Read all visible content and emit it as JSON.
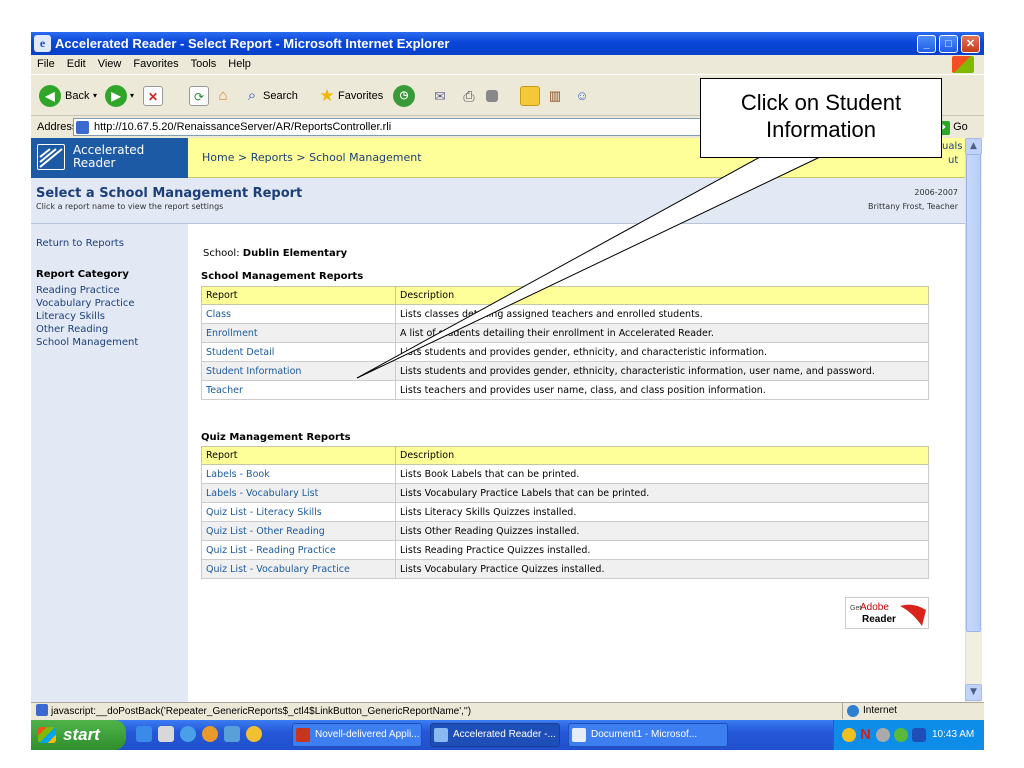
{
  "window": {
    "title": "Accelerated Reader - Select Report - Microsoft Internet Explorer",
    "minimize": "_",
    "maximize": "□",
    "close": "✕"
  },
  "menu": [
    "File",
    "Edit",
    "View",
    "Favorites",
    "Tools",
    "Help"
  ],
  "toolbar": {
    "back": "Back",
    "search": "Search",
    "favorites": "Favorites"
  },
  "address": {
    "label": "Address",
    "url": "http://10.67.5.20/RenaissanceServer/AR/ReportsController.rli",
    "go": "Go"
  },
  "app": {
    "logo_line1": "Accelerated",
    "logo_line2": "Reader",
    "breadcrumb": "Home > Reports > School Management",
    "manuals_fragment": "uals",
    "logout_fragment": "ut",
    "page_title": "Select a School Management Report",
    "page_subtitle": "Click a report name to view the report settings",
    "year": "2006-2007",
    "user": "Brittany Frost, Teacher"
  },
  "sidebar": {
    "return_link": "Return to Reports",
    "category_heading": "Report Category",
    "items": [
      "Reading Practice",
      "Vocabulary Practice",
      "Literacy Skills",
      "Other Reading",
      "School Management"
    ]
  },
  "school": {
    "label": "School:",
    "name": "Dublin Elementary"
  },
  "school_reports": {
    "heading": "School Management Reports",
    "col_report": "Report",
    "col_desc": "Description",
    "rows": [
      {
        "name": "Class",
        "desc": "Lists classes detailing assigned teachers and enrolled students."
      },
      {
        "name": "Enrollment",
        "desc": "A list of students detailing their enrollment in Accelerated Reader."
      },
      {
        "name": "Student Detail",
        "desc": "Lists students and provides gender, ethnicity, and characteristic information."
      },
      {
        "name": "Student Information",
        "desc": "Lists students and provides gender, ethnicity, characteristic information, user name, and password."
      },
      {
        "name": "Teacher",
        "desc": "Lists teachers and provides user name, class, and class position information."
      }
    ]
  },
  "quiz_reports": {
    "heading": "Quiz Management Reports",
    "col_report": "Report",
    "col_desc": "Description",
    "rows": [
      {
        "name": "Labels - Book",
        "desc": "Lists Book Labels that can be printed."
      },
      {
        "name": "Labels - Vocabulary List",
        "desc": "Lists Vocabulary Practice Labels that can be printed."
      },
      {
        "name": "Quiz List - Literacy Skills",
        "desc": "Lists Literacy Skills Quizzes installed."
      },
      {
        "name": "Quiz List - Other Reading",
        "desc": "Lists Other Reading Quizzes installed."
      },
      {
        "name": "Quiz List - Reading Practice",
        "desc": "Lists Reading Practice Quizzes installed."
      },
      {
        "name": "Quiz List - Vocabulary Practice",
        "desc": "Lists Vocabulary Practice Quizzes installed."
      }
    ]
  },
  "adobe": {
    "get": "Get",
    "adobe": "Adobe",
    "reader": "Reader"
  },
  "status": {
    "text": "javascript:__doPostBack('Repeater_GenericReports$_ctl4$LinkButton_GenericReportName','')",
    "zone": "Internet"
  },
  "taskbar": {
    "start": "start",
    "tasks": [
      "Novell-delivered Appli...",
      "Accelerated Reader -...",
      "Document1 - Microsof..."
    ],
    "clock": "10:43 AM",
    "tray_n": "N"
  },
  "callout": {
    "text": "Click on Student Information"
  },
  "colors": {
    "titlebar": "#0a46d8",
    "highlight_yellow": "#ffff99",
    "app_blue": "#1d5aa5",
    "link": "#1c5aa0"
  }
}
